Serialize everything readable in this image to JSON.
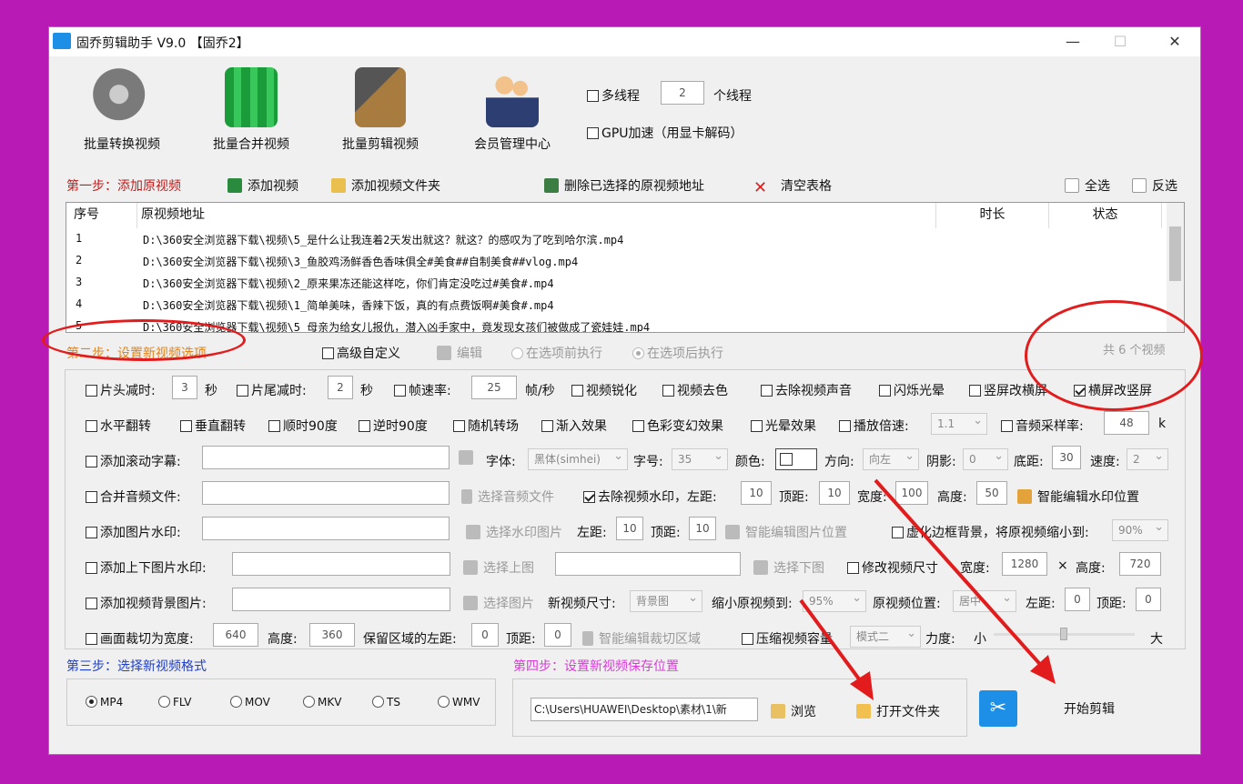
{
  "window": {
    "title": "固乔剪辑助手 V9.0 【固乔2】",
    "minimize": "—",
    "maximize": "☐",
    "close": "✕"
  },
  "toolbar": {
    "convert": "批量转换视频",
    "merge": "批量合并视频",
    "edit": "批量剪辑视频",
    "member": "会员管理中心"
  },
  "threads": {
    "multithread": "多线程",
    "count": "2",
    "unit": "个线程",
    "gpu": "GPU加速（用显卡解码）"
  },
  "step1": {
    "label": "第一步：添加原视频",
    "add_video": "添加视频",
    "add_folder": "添加视频文件夹",
    "delete_selected": "删除已选择的原视频地址",
    "clear_table": "清空表格",
    "select_all": "全选",
    "invert": "反选"
  },
  "table": {
    "headers": [
      "序号",
      "原视频地址",
      "时长",
      "状态"
    ],
    "rows": [
      {
        "no": "1",
        "path": "D:\\360安全浏览器下载\\视频\\5_是什么让我连着2天发出就这？就这？的感叹为了吃到哈尔滨.mp4"
      },
      {
        "no": "2",
        "path": "D:\\360安全浏览器下载\\视频\\3_鱼胶鸡汤鲜香色香味俱全#美食##自制美食##vlog.mp4"
      },
      {
        "no": "3",
        "path": "D:\\360安全浏览器下载\\视频\\2_原来果冻还能这样吃，你们肯定没吃过#美食#.mp4"
      },
      {
        "no": "4",
        "path": "D:\\360安全浏览器下载\\视频\\1_简单美味，香辣下饭，真的有点费饭啊#美食#.mp4"
      },
      {
        "no": "5",
        "path": "D:\\360安全浏览器下载\\视频\\5_母亲为给女儿报仇，潜入凶手家中，竟发现女孩们被做成了瓷娃娃.mp4"
      }
    ]
  },
  "step2": {
    "label": "第二步：设置新视频选项",
    "advanced": "高级自定义",
    "edit": "编辑",
    "before": "在选项前执行",
    "after": "在选项后执行",
    "count": "共 6 个视频"
  },
  "opts": {
    "head_cut": "片头减时:",
    "head_val": "3",
    "sec": "秒",
    "tail_cut": "片尾减时:",
    "tail_val": "2",
    "fps": "帧速率:",
    "fps_val": "25",
    "fps_unit": "帧/秒",
    "sharpen": "视频锐化",
    "decolor": "视频去色",
    "mute": "去除视频声音",
    "flash": "闪烁光晕",
    "v2h": "竖屏改横屏",
    "h2v": "横屏改竖屏",
    "hflip": "水平翻转",
    "vflip": "垂直翻转",
    "cw90": "顺时90度",
    "ccw90": "逆时90度",
    "randtrans": "随机转场",
    "fadein": "渐入效果",
    "colorfx": "色彩变幻效果",
    "halo": "光晕效果",
    "speed": "播放倍速:",
    "speed_val": "1.1",
    "samplerate": "音频采样率:",
    "samplerate_val": "48",
    "k": "k",
    "scroll_sub": "添加滚动字幕:",
    "font": "字体:",
    "font_val": "黑体(simhei)",
    "size": "字号:",
    "size_val": "35",
    "color": "颜色:",
    "direction": "方向:",
    "dir_val": "向左",
    "shadow": "阴影:",
    "shadow_val": "0",
    "bottom": "底距:",
    "bottom_val": "30",
    "rate": "速度:",
    "rate_val": "2",
    "merge_audio": "合并音频文件:",
    "choose_audio": "选择音频文件",
    "remove_wm": "去除视频水印，左距:",
    "wm_left": "10",
    "top": "顶距:",
    "wm_top": "10",
    "width": "宽度:",
    "wm_width": "100",
    "height": "高度:",
    "wm_height": "50",
    "smart_wm": "智能编辑水印位置",
    "img_wm": "添加图片水印:",
    "choose_wm_img": "选择水印图片",
    "left": "左距:",
    "img_left": "10",
    "img_top": "10",
    "smart_img": "智能编辑图片位置",
    "blur_bg": "虚化边框背景，将原视频缩小到:",
    "blur_val": "90%",
    "tb_wm": "添加上下图片水印:",
    "choose_top": "选择上图",
    "choose_bottom": "选择下图",
    "resize": "修改视频尺寸",
    "res_width": "1280",
    "x": "×",
    "res_height": "720",
    "bg_img": "添加视频背景图片:",
    "choose_img": "选择图片",
    "new_size": "新视频尺寸:",
    "new_size_val": "背景图",
    "shrink": "缩小原视频到:",
    "shrink_val": "95%",
    "pos": "原视频位置:",
    "pos_val": "居中",
    "bg_left": "0",
    "bg_top": "0",
    "crop": "画面裁切为宽度:",
    "crop_w": "640",
    "crop_h": "360",
    "keep": "保留区域的左距:",
    "crop_left": "0",
    "crop_top": "0",
    "smart_crop": "智能编辑裁切区域",
    "compress": "压缩视频容量",
    "mode_val": "模式二",
    "strength": "力度:",
    "small": "小",
    "big": "大"
  },
  "step3": {
    "label": "第三步：选择新视频格式",
    "formats": [
      "MP4",
      "FLV",
      "MOV",
      "MKV",
      "TS",
      "WMV"
    ]
  },
  "step4": {
    "label": "第四步：设置新视频保存位置",
    "path": "C:\\Users\\HUAWEI\\Desktop\\素材\\1\\新",
    "browse": "浏览",
    "open_folder": "打开文件夹",
    "start": "开始剪辑"
  },
  "colors": {
    "accent_red": "#e21c1c",
    "step_blue": "#1f3fc9",
    "step_pink": "#d93ad9"
  }
}
